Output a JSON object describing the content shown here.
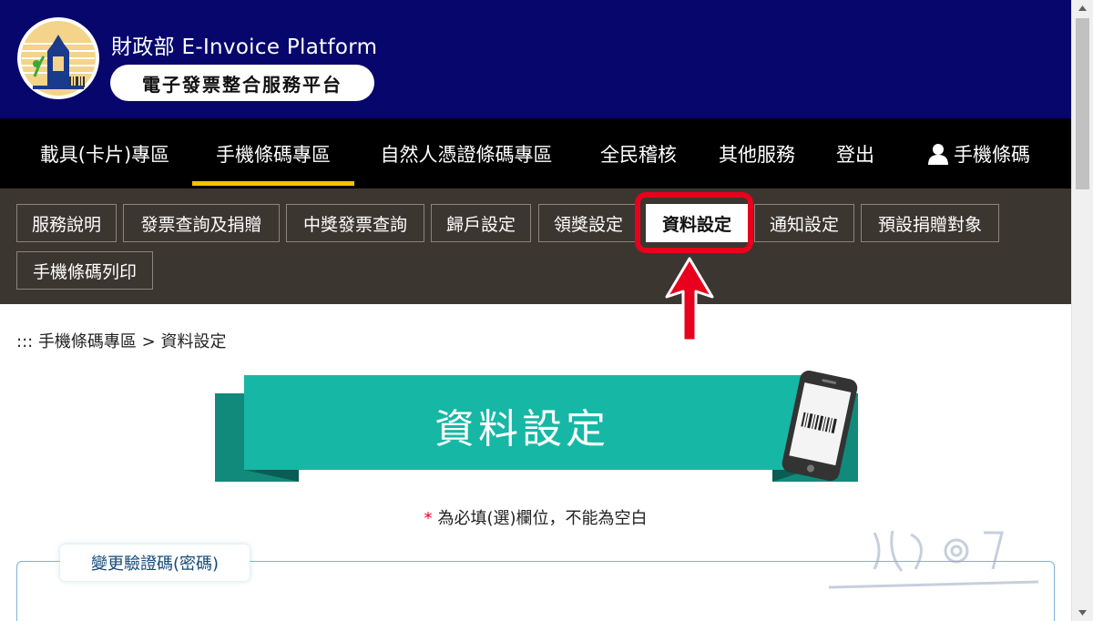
{
  "header": {
    "title": "財政部 E-Invoice Platform",
    "subtitle": "電子發票整合服務平台"
  },
  "main_nav": {
    "items": [
      {
        "label": "載具(卡片)專區"
      },
      {
        "label": "手機條碼專區",
        "active": true
      },
      {
        "label": "自然人憑證條碼專區"
      },
      {
        "label": "全民稽核"
      },
      {
        "label": "其他服務"
      },
      {
        "label": "登出"
      },
      {
        "label": "手機條碼",
        "icon": "user-icon"
      }
    ]
  },
  "sub_nav": {
    "items": [
      {
        "label": "服務說明"
      },
      {
        "label": "發票查詢及捐贈"
      },
      {
        "label": "中獎發票查詢"
      },
      {
        "label": "歸戶設定"
      },
      {
        "label": "領獎設定"
      },
      {
        "label": "資料設定",
        "active": true
      },
      {
        "label": "通知設定"
      },
      {
        "label": "預設捐贈對象"
      },
      {
        "label": "手機條碼列印"
      }
    ]
  },
  "breadcrumb": {
    "prefix": ":::",
    "section": "手機條碼專區",
    "separator": ">",
    "current": "資料設定"
  },
  "banner": {
    "title": "資料設定"
  },
  "required_note": {
    "star": "*",
    "text": "為必填(選)欄位，不能為空白"
  },
  "fieldset": {
    "legend": "變更驗證碼(密碼)"
  },
  "colors": {
    "header_bg": "#06066c",
    "nav_bg": "#000000",
    "subnav_bg": "#3b3630",
    "accent_yellow": "#f1c400",
    "teal": "#17b7a6",
    "highlight_red": "#e8001c"
  }
}
